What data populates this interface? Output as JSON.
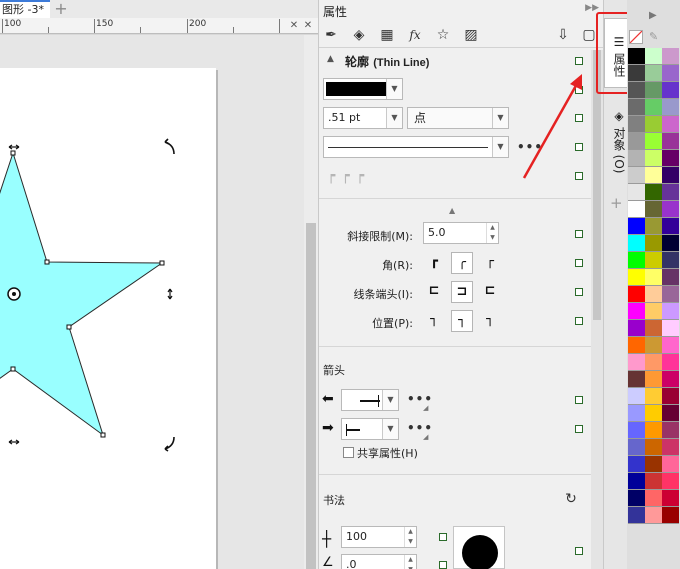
{
  "canvas": {
    "tab_title": "图形 -3*",
    "ruler_labels": [
      "100",
      "150",
      "200"
    ]
  },
  "docker": {
    "title": "属性",
    "outline_title_cn": "轮廓",
    "outline_title_en": "(Thin Line)",
    "outline_color": "#000000",
    "width_value": ".51 pt",
    "unit_value": "点",
    "miter_label": "斜接限制(M):",
    "miter_value": "5.0",
    "corner_label": "角(R):",
    "linecap_label": "线条端头(I):",
    "position_label": "位置(P):",
    "arrows_title": "箭头",
    "share_attr_label": "共享属性(H)",
    "calligraphy_title": "书法",
    "stretch_value": "100",
    "angle_value": ".0"
  },
  "vertical_tabs": {
    "properties": "属性",
    "objects": "对象 (O)"
  },
  "palette": {
    "col1": [
      "#000000",
      "#3a3a3a",
      "#555555",
      "#6b6b6b",
      "#808080",
      "#999999",
      "#b3b3b3",
      "#cccccc",
      "#e6e6e6",
      "#ffffff",
      "#0000ff",
      "#00ffff",
      "#00ff00",
      "#ffff00",
      "#ff0000",
      "#ff00ff",
      "#9900cc",
      "#ff6600",
      "#ff99cc",
      "#663333",
      "#ccccff",
      "#9999ff",
      "#6666ff",
      "#6666cc",
      "#3333cc",
      "#000099",
      "#000066",
      "#333399"
    ],
    "col2": [
      "#ccffcc",
      "#99cc99",
      "#669966",
      "#66cc66",
      "#99cc33",
      "#99ff33",
      "#ccff66",
      "#ffff99",
      "#336600",
      "#666633",
      "#999933",
      "#999900",
      "#cccc00",
      "#ffff66",
      "#ffcc99",
      "#ffcc66",
      "#cc6633",
      "#cc9933",
      "#ff9966",
      "#ff9933",
      "#ffcc33",
      "#ffcc00",
      "#ff9900",
      "#cc6600",
      "#993300",
      "#cc3333",
      "#ff6666",
      "#ff9999"
    ],
    "col3": [
      "#cc99cc",
      "#9966cc",
      "#6633cc",
      "#9999cc",
      "#cc66cc",
      "#993399",
      "#660066",
      "#330066",
      "#663399",
      "#9933cc",
      "#330099",
      "#000033",
      "#333366",
      "#663366",
      "#996699",
      "#cc99ff",
      "#ffccff",
      "#ff66cc",
      "#ff3399",
      "#cc0066",
      "#990033",
      "#660033",
      "#993366",
      "#cc3366",
      "#ff6699",
      "#ff3366",
      "#cc0033",
      "#990000"
    ]
  }
}
